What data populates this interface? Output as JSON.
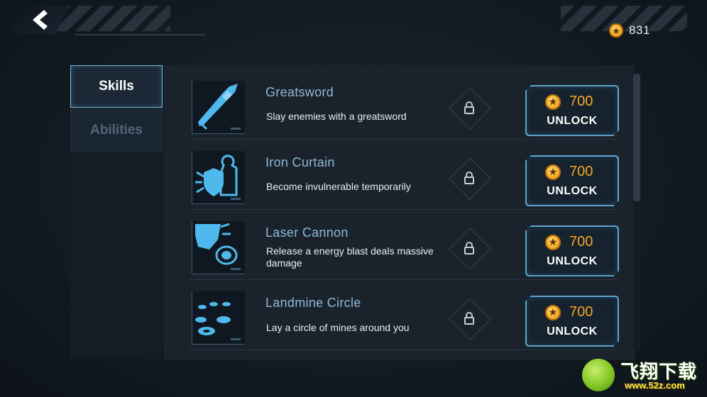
{
  "currency": {
    "amount": "831",
    "icon": "star-coin-icon"
  },
  "tabs": [
    {
      "label": "Skills",
      "active": true
    },
    {
      "label": "Abilities",
      "active": false
    }
  ],
  "skills": [
    {
      "title": "Greatsword",
      "description": "Slay enemies with a greatsword",
      "price": "700",
      "button": "UNLOCK",
      "icon": "greatsword-icon"
    },
    {
      "title": "Iron Curtain",
      "description": "Become invulnerable temporarily",
      "price": "700",
      "button": "UNLOCK",
      "icon": "shield-figure-icon"
    },
    {
      "title": "Laser Cannon",
      "description": "Release a energy blast deals massive damage",
      "price": "700",
      "button": "UNLOCK",
      "icon": "laser-cannon-icon"
    },
    {
      "title": "Landmine Circle",
      "description": "Lay a circle of mines around you",
      "price": "700",
      "button": "UNLOCK",
      "icon": "landmine-icon"
    }
  ],
  "watermark": {
    "brand": "飞翔下载",
    "url": "www.52z.com"
  },
  "colors": {
    "accent": "#5ea3cc",
    "price": "#f5a623",
    "title": "#8fb9d6"
  }
}
